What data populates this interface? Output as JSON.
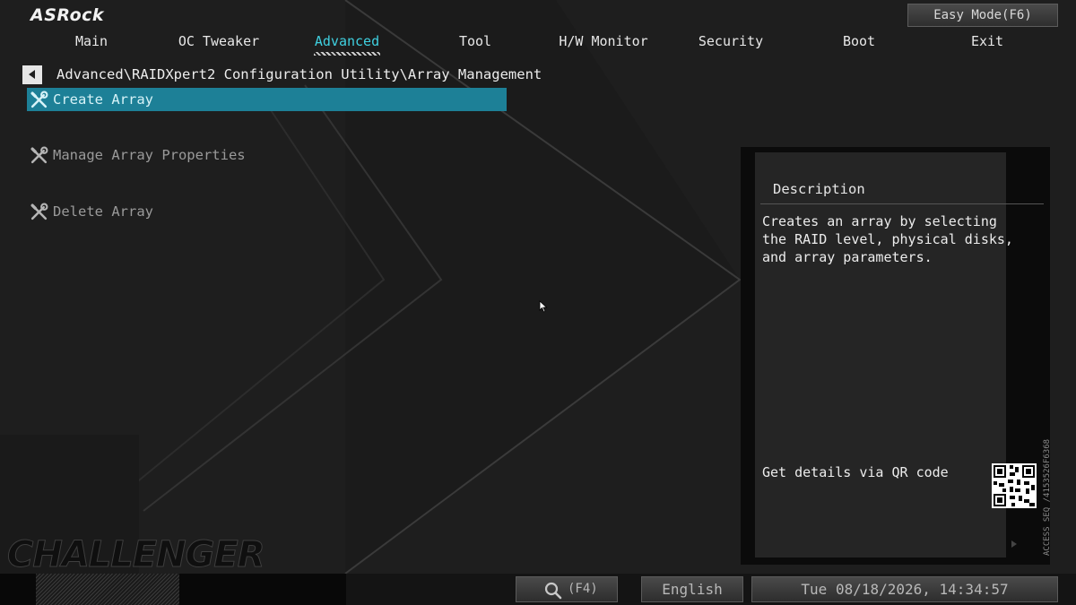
{
  "brand": {
    "logo": "ASRock",
    "edition": "CHALLENGER"
  },
  "header": {
    "easy_mode": "Easy Mode(F6)",
    "tabs": [
      {
        "label": "Main",
        "active": false
      },
      {
        "label": "OC Tweaker",
        "active": false
      },
      {
        "label": "Advanced",
        "active": true
      },
      {
        "label": "Tool",
        "active": false
      },
      {
        "label": "H/W Monitor",
        "active": false
      },
      {
        "label": "Security",
        "active": false
      },
      {
        "label": "Boot",
        "active": false
      },
      {
        "label": "Exit",
        "active": false
      }
    ]
  },
  "breadcrumb": "Advanced\\RAIDXpert2 Configuration Utility\\Array Management",
  "menu": {
    "items": [
      {
        "label": "Create Array",
        "icon": "wrench-screwdriver-icon",
        "selected": true
      },
      {
        "label": "Manage Array Properties",
        "icon": "wrench-screwdriver-icon",
        "selected": false
      },
      {
        "label": "Delete Array",
        "icon": "wrench-screwdriver-icon",
        "selected": false
      }
    ]
  },
  "description": {
    "title": "Description",
    "text": "Creates an array by selecting the RAID level, physical disks, and array parameters.",
    "qr_label": "Get details via QR code",
    "access_seq": "ACCESS SEQ /4153526F6368"
  },
  "footer": {
    "search_key": "(F4)",
    "language": "English",
    "datetime": "Tue 08/18/2026, 14:34:57"
  },
  "colors": {
    "accent": "#3fd0e0",
    "selection": "#1d8097",
    "background": "#1e1e1e"
  }
}
